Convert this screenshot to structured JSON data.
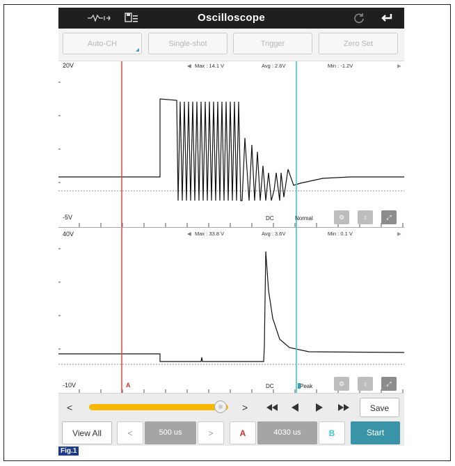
{
  "app": {
    "title": "Oscilloscope"
  },
  "toolbar": {
    "buttons": [
      {
        "label": "Auto-CH"
      },
      {
        "label": "Single-shot"
      },
      {
        "label": "Trigger"
      },
      {
        "label": "Zero Set"
      }
    ]
  },
  "channel1": {
    "top_scale": "20V",
    "bottom_scale": "-5V",
    "max": "Max : 14.1 V",
    "avg": "Avg : 2.6V",
    "min": "Min : -1.2V",
    "coupling": "DC",
    "mode": "Normal"
  },
  "channel2": {
    "top_scale": "40V",
    "bottom_scale": "-10V",
    "max": "Max : 33.8 V",
    "avg": "Avg : 3.6V",
    "min": "Min : 0.1 V",
    "coupling": "DC",
    "mode": "Peak",
    "cursor_a_label": "A"
  },
  "cursor_colors": {
    "a": "#d9534f",
    "b": "#3cc8d0"
  },
  "accent_colors": {
    "slider": "#f6b800",
    "start": "#3a94a8"
  },
  "controls": {
    "prev": "<",
    "next": ">",
    "save_label": "Save",
    "slider_position": 0.95
  },
  "bottom": {
    "view_all": "View All",
    "time_prev": "<",
    "time_value": "500 us",
    "time_next": ">",
    "cursor_a": "A",
    "cursor_value": "4030 us",
    "cursor_b": "B",
    "start": "Start"
  },
  "caption": "Fig.1",
  "icons": [
    "signal-icon",
    "save-file-icon",
    "refresh-icon",
    "back-icon",
    "expand-icon",
    "fast-rewind-icon",
    "step-back-icon",
    "step-forward-icon",
    "fast-forward-icon"
  ]
}
